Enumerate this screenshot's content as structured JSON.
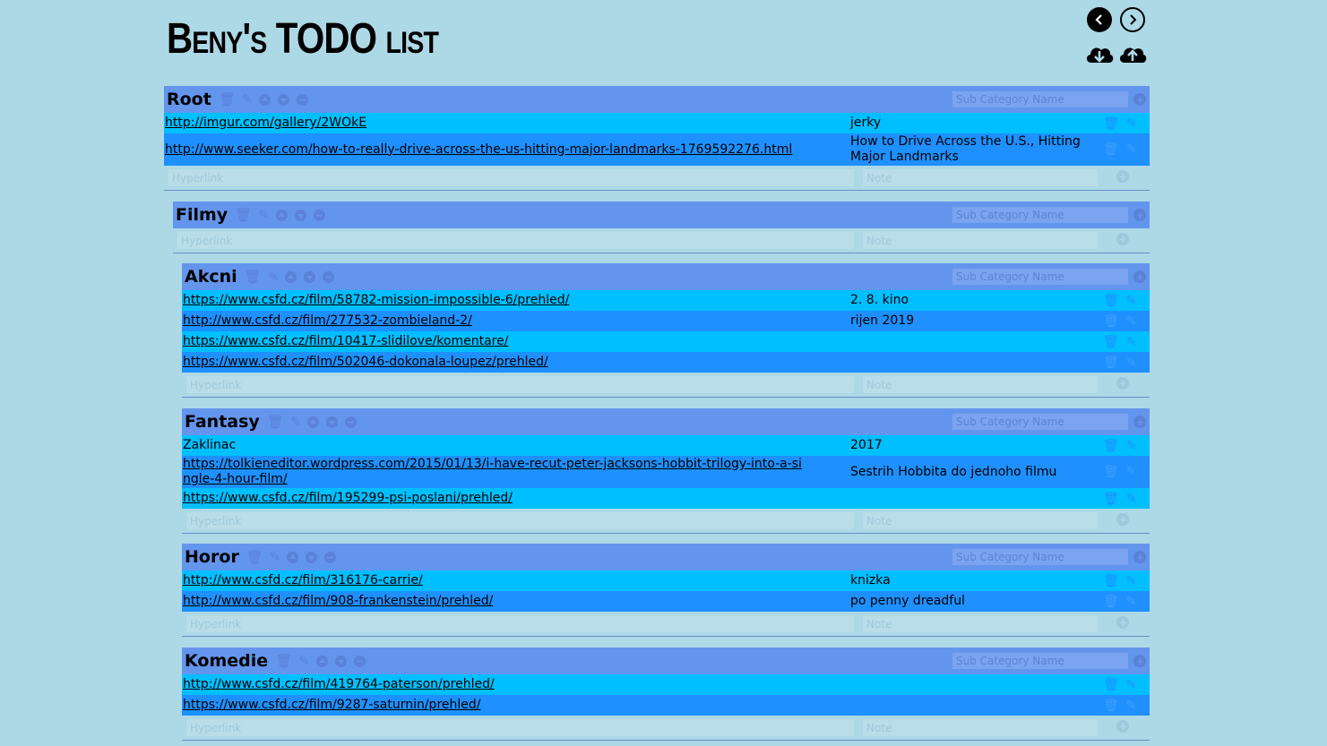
{
  "app": {
    "title": "Beny's TODO list"
  },
  "icons": {
    "prev": "chevron-left-icon",
    "next": "chevron-right-icon",
    "download": "cloud-download-icon",
    "upload": "cloud-upload-icon",
    "delete": "trash-icon",
    "edit": "pencil-icon",
    "move_up": "arrow-up-circle-icon",
    "move_down": "arrow-down-circle-icon",
    "collapse": "minus-circle-icon",
    "add": "plus-circle-icon"
  },
  "colors": {
    "background": "#add8e6",
    "category_header": "#6495ed",
    "row_light": "#00bfff",
    "row_dark": "#1e90ff"
  },
  "placeholders": {
    "sub_category": "Sub Category Name",
    "hyperlink": "Hyperlink",
    "note": "Note"
  },
  "categories": [
    {
      "name": "Root",
      "items": [
        {
          "link": "http://imgur.com/gallery/2WOkE",
          "note": "jerky"
        },
        {
          "link": "http://www.seeker.com/how-to-really-drive-across-the-us-hitting-major-landmarks-1769592276.html",
          "note": "How to Drive Across the U.S., Hitting Major Landmarks"
        }
      ]
    },
    {
      "name": "Filmy",
      "items": []
    },
    {
      "name": "Akcni",
      "items": [
        {
          "link": "https://www.csfd.cz/film/58782-mission-impossible-6/prehled/",
          "note": "2. 8. kino"
        },
        {
          "link": "http://www.csfd.cz/film/277532-zombieland-2/",
          "note": "rijen 2019"
        },
        {
          "link": "https://www.csfd.cz/film/10417-slidilove/komentare/",
          "note": ""
        },
        {
          "link": "https://www.csfd.cz/film/502046-dokonala-loupez/prehled/",
          "note": ""
        }
      ]
    },
    {
      "name": "Fantasy",
      "items": [
        {
          "text": "Zaklinac",
          "note": "2017"
        },
        {
          "link": "https://tolkieneditor.wordpress.com/2015/01/13/i-have-recut-peter-jacksons-hobbit-trilogy-into-a-single-4-hour-film/",
          "note": "Sestrih Hobbita do jednoho filmu"
        },
        {
          "link": "https://www.csfd.cz/film/195299-psi-poslani/prehled/",
          "note": ""
        }
      ]
    },
    {
      "name": "Horor",
      "items": [
        {
          "link": "http://www.csfd.cz/film/316176-carrie/",
          "note": "knizka"
        },
        {
          "link": "http://www.csfd.cz/film/908-frankenstein/prehled/",
          "note": "po penny dreadful"
        }
      ]
    },
    {
      "name": "Komedie",
      "items": [
        {
          "link": "http://www.csfd.cz/film/419764-paterson/prehled/",
          "note": ""
        },
        {
          "link": "https://www.csfd.cz/film/9287-saturnin/prehled/",
          "note": ""
        }
      ]
    }
  ]
}
